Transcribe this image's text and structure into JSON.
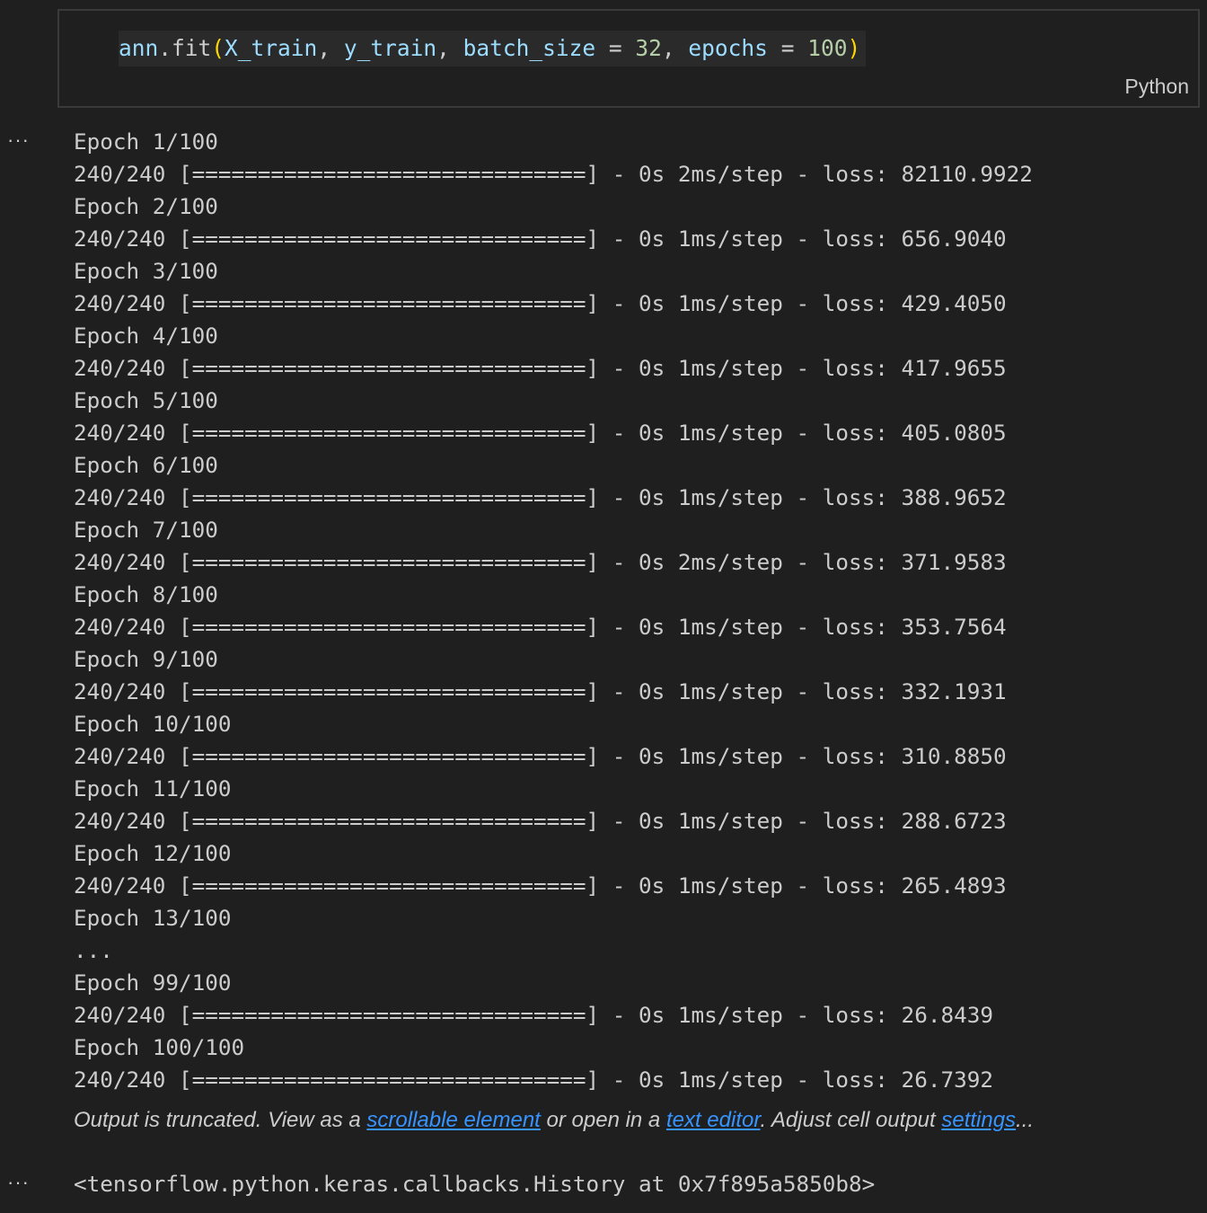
{
  "code_cell": {
    "tokens": {
      "t1": "ann",
      "t2": ".fit",
      "t3": "(",
      "t4": "X_train",
      "t5": ", ",
      "t6": "y_train",
      "t7": ", ",
      "t8": "batch_size",
      "t9": " = ",
      "t10": "32",
      "t11": ", ",
      "t12": "epochs",
      "t13": " = ",
      "t14": "100",
      "t15": ")"
    },
    "language_label": "Python"
  },
  "gutter": {
    "output_marker_1": "···",
    "output_marker_2": "···"
  },
  "output": {
    "lines": [
      "Epoch 1/100",
      "240/240 [==============================] - 0s 2ms/step - loss: 82110.9922",
      "Epoch 2/100",
      "240/240 [==============================] - 0s 1ms/step - loss: 656.9040",
      "Epoch 3/100",
      "240/240 [==============================] - 0s 1ms/step - loss: 429.4050",
      "Epoch 4/100",
      "240/240 [==============================] - 0s 1ms/step - loss: 417.9655",
      "Epoch 5/100",
      "240/240 [==============================] - 0s 1ms/step - loss: 405.0805",
      "Epoch 6/100",
      "240/240 [==============================] - 0s 1ms/step - loss: 388.9652",
      "Epoch 7/100",
      "240/240 [==============================] - 0s 2ms/step - loss: 371.9583",
      "Epoch 8/100",
      "240/240 [==============================] - 0s 1ms/step - loss: 353.7564",
      "Epoch 9/100",
      "240/240 [==============================] - 0s 1ms/step - loss: 332.1931",
      "Epoch 10/100",
      "240/240 [==============================] - 0s 1ms/step - loss: 310.8850",
      "Epoch 11/100",
      "240/240 [==============================] - 0s 1ms/step - loss: 288.6723",
      "Epoch 12/100",
      "240/240 [==============================] - 0s 1ms/step - loss: 265.4893",
      "Epoch 13/100",
      "...",
      "Epoch 99/100",
      "240/240 [==============================] - 0s 1ms/step - loss: 26.8439",
      "Epoch 100/100",
      "240/240 [==============================] - 0s 1ms/step - loss: 26.7392"
    ],
    "truncated_note": {
      "prefix": "Output is truncated. View as a ",
      "link_scrollable": "scrollable element",
      "middle": " or open in a ",
      "link_text_editor": "text editor",
      "suffix_pre": ". Adjust cell output ",
      "link_settings": "settings",
      "suffix": "..."
    },
    "result": "<tensorflow.python.keras.callbacks.History at 0x7f895a5850b8>"
  },
  "colors": {
    "background": "#1f1f1f",
    "identifier": "#9cdcfe",
    "bracket": "#ffd700",
    "number": "#b5cea8",
    "link": "#3794ff"
  }
}
